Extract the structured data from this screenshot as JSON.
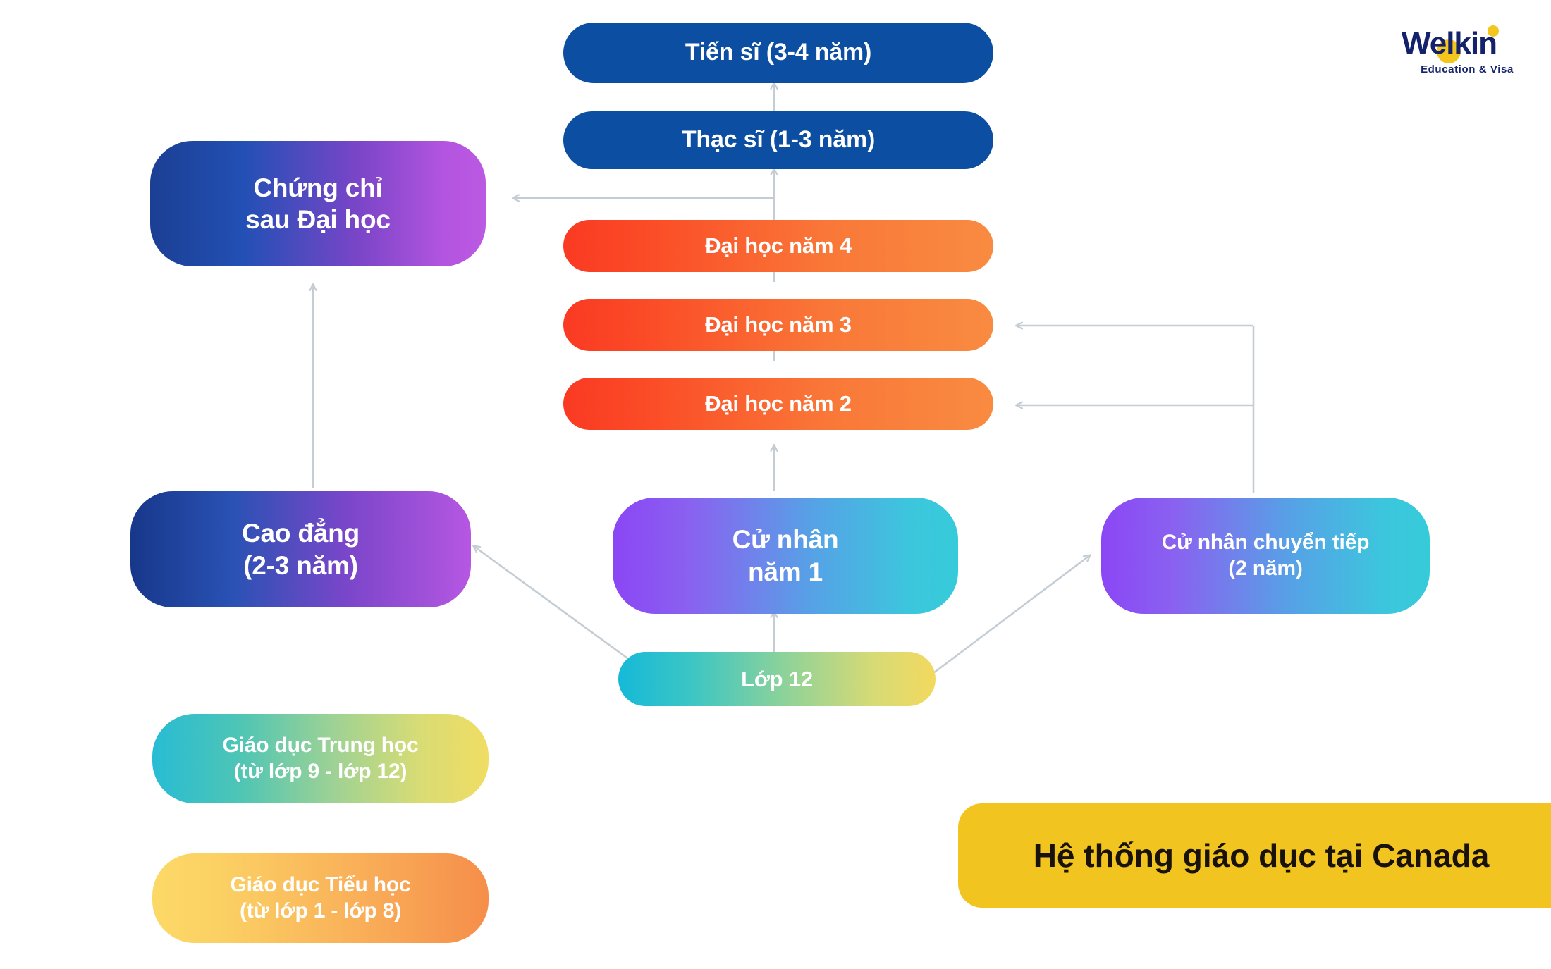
{
  "brand": {
    "name": "Welkin",
    "tagline": "Education & Visa"
  },
  "title_banner": {
    "text": "Hệ thống giáo dục tại Canada",
    "bg_color": "#f2c420",
    "text_color": "#18120a"
  },
  "chart_data": {
    "type": "diagram",
    "title": "Hệ thống giáo dục tại Canada",
    "nodes": [
      {
        "id": "doctorate",
        "label": "Tiến sĩ (3-4 năm)",
        "color": "#0b4ea2"
      },
      {
        "id": "masters",
        "label": "Thạc sĩ (1-3 năm)",
        "color": "#0b4ea2"
      },
      {
        "id": "postgrad",
        "label": "Chứng chỉ\nsau Đại học",
        "color": "#1b3f93 → #bb59e2"
      },
      {
        "id": "uni4",
        "label": "Đại học năm 4",
        "color": "#fa3a23 → #f98b41"
      },
      {
        "id": "uni3",
        "label": "Đại học năm 3",
        "color": "#fa3a23 → #f98b41"
      },
      {
        "id": "uni2",
        "label": "Đại học năm 2",
        "color": "#fa3a23 → #f98b41"
      },
      {
        "id": "college",
        "label": "Cao đẳng\n(2-3 năm)",
        "color": "#17378a → #b657e2"
      },
      {
        "id": "bachelor1",
        "label": "Cử nhân\nnăm 1",
        "color": "#8b46f5 → #36cbd9"
      },
      {
        "id": "transfer",
        "label": "Cử nhân chuyển tiếp\n(2 năm)",
        "color": "#8b46f5 → #36cbd9"
      },
      {
        "id": "grade12",
        "label": "Lớp 12",
        "color": "#15b9d8 → #f3d95e"
      },
      {
        "id": "secondary",
        "label": "Giáo dục Trung học\n(từ lớp 9 - lớp 12)",
        "color": "#28bcd4 → #f0dd63"
      },
      {
        "id": "primary",
        "label": "Giáo dục Tiểu học\n(từ lớp 1 - lớp 8)",
        "color": "#fcd967 → #f58e4a"
      }
    ],
    "edges": [
      {
        "from": "masters",
        "to": "doctorate",
        "style": "arrow-up"
      },
      {
        "from": "uni4",
        "to": "masters",
        "style": "arrow-up"
      },
      {
        "from": "uni4",
        "to": "postgrad",
        "style": "arrow-left"
      },
      {
        "from": "uni3",
        "to": "uni4",
        "style": "arrow-up"
      },
      {
        "from": "uni2",
        "to": "uni3",
        "style": "arrow-up"
      },
      {
        "from": "bachelor1",
        "to": "uni2",
        "style": "arrow-up"
      },
      {
        "from": "grade12",
        "to": "bachelor1",
        "style": "arrow-up"
      },
      {
        "from": "grade12",
        "to": "college",
        "style": "arrow-diagonal-up-left"
      },
      {
        "from": "grade12",
        "to": "transfer",
        "style": "arrow-diagonal-up-right"
      },
      {
        "from": "college",
        "to": "postgrad",
        "style": "arrow-up"
      },
      {
        "from": "transfer",
        "to": "uni3",
        "style": "arrow-elbow-left"
      },
      {
        "from": "transfer",
        "to": "uni2",
        "style": "arrow-elbow-left"
      }
    ],
    "connector_color": "#c5cdd4"
  },
  "nodes": {
    "doctorate": {
      "label": "Tiến sĩ (3-4 năm)"
    },
    "masters": {
      "label": "Thạc sĩ (1-3 năm)"
    },
    "postgrad": {
      "label": "Chứng chỉ\nsau Đại học"
    },
    "uni4": {
      "label": "Đại học năm 4"
    },
    "uni3": {
      "label": "Đại học năm 3"
    },
    "uni2": {
      "label": "Đại học năm 2"
    },
    "college": {
      "label": "Cao đẳng\n(2-3 năm)"
    },
    "bachelor1": {
      "label": "Cử nhân\nnăm 1"
    },
    "transfer": {
      "label": "Cử nhân chuyển tiếp\n(2 năm)"
    },
    "grade12": {
      "label": "Lớp 12"
    },
    "secondary": {
      "label": "Giáo dục Trung học\n(từ lớp 9 - lớp 12)"
    },
    "primary": {
      "label": "Giáo dục Tiểu học\n(từ lớp 1 - lớp 8)"
    }
  }
}
